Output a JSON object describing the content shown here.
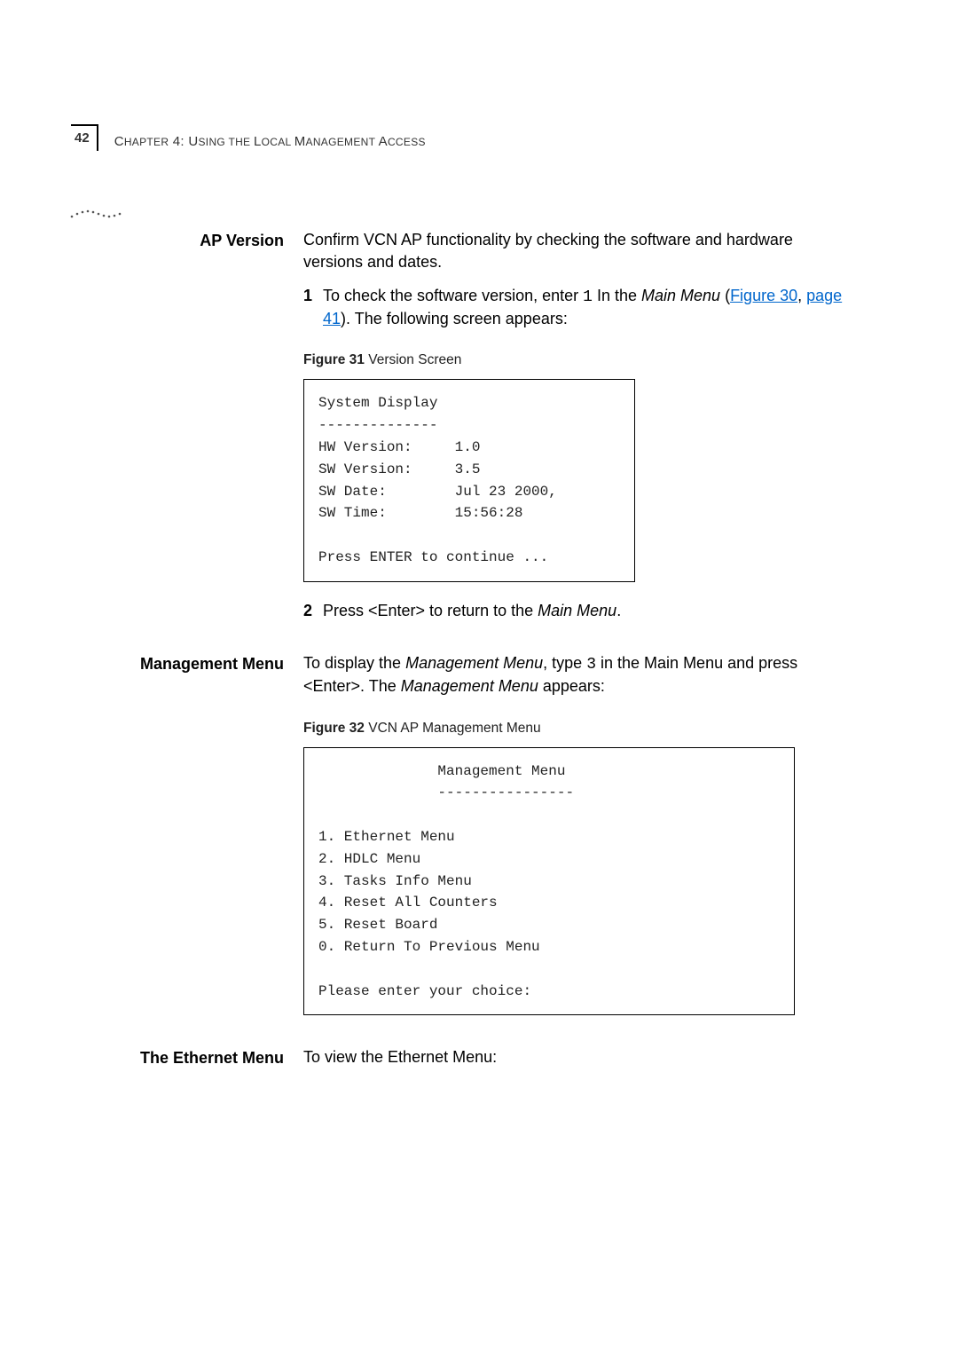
{
  "page_number": "42",
  "chapter_prefix": "C",
  "chapter_rest": "HAPTER",
  "chapter_num": " 4: U",
  "chapter_tail": "SING THE ",
  "chapter_l": "L",
  "chapter_local": "OCAL ",
  "chapter_m": "M",
  "chapter_mgmt": "ANAGEMENT ",
  "chapter_a": "A",
  "chapter_access": "CCESS",
  "ap_version": {
    "heading": "AP Version",
    "intro": "Confirm VCN AP functionality by checking the software and hardware versions and dates.",
    "step1_pre": "To check the software version, enter ",
    "step1_code": "1",
    "step1_mid": " In the ",
    "step1_menu": "Main Menu",
    "step1_open": " (",
    "step1_link1": "Figure 30",
    "step1_comma": ", ",
    "step1_link2": "page 41",
    "step1_post": "). The following screen appears:",
    "fig31_bold": "Figure 31",
    "fig31_rest": "   Version Screen",
    "code1": "System Display\n--------------\nHW Version:     1.0\nSW Version:     3.5\nSW Date:        Jul 23 2000,\nSW Time:        15:56:28\n\nPress ENTER to continue ...",
    "step2_pre": "Press <Enter> to return to the ",
    "step2_menu": "Main Menu",
    "step2_post": "."
  },
  "mgmt": {
    "heading": "Management Menu",
    "intro_pre": "To display the ",
    "intro_menu": "Management Menu",
    "intro_mid": ", type ",
    "intro_code": "3",
    "intro_mid2": " in the Main Menu and press <Enter>. The ",
    "intro_menu2": "Management Menu",
    "intro_post": " appears:",
    "fig32_bold": "Figure 32",
    "fig32_rest": "   VCN AP Management Menu",
    "code2": "              Management Menu\n              ----------------\n\n1. Ethernet Menu\n2. HDLC Menu\n3. Tasks Info Menu\n4. Reset All Counters\n5. Reset Board\n0. Return To Previous Menu\n\nPlease enter your choice:"
  },
  "eth": {
    "heading": "The Ethernet Menu",
    "text": "To view the Ethernet Menu:"
  }
}
